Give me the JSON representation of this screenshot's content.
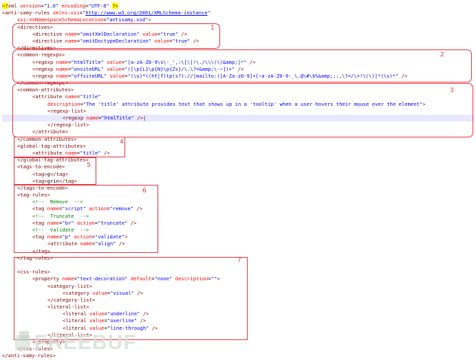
{
  "code": {
    "lines": [
      {
        "indent": 0,
        "parts": [
          {
            "c": "pi",
            "t": "<?"
          },
          {
            "c": "t",
            "t": "xml"
          },
          {
            "c": "a",
            "t": " version"
          },
          {
            "c": "x",
            "t": "="
          },
          {
            "c": "v",
            "t": "\"1.0\""
          },
          {
            "c": "a",
            "t": " encoding"
          },
          {
            "c": "x",
            "t": "="
          },
          {
            "c": "v",
            "t": "\"UTF-8\" "
          },
          {
            "c": "pi",
            "t": "?>"
          }
        ]
      },
      {
        "indent": 0,
        "parts": [
          {
            "c": "t",
            "t": "<anti-samy-rules"
          },
          {
            "c": "a",
            "t": " xmlns:xsi"
          },
          {
            "c": "x",
            "t": "="
          },
          {
            "c": "v",
            "t": "\""
          },
          {
            "c": "u",
            "t": "http://www.w3.org/2001/XMLSchema-instance"
          },
          {
            "c": "v",
            "t": "\""
          }
        ]
      },
      {
        "indent": 1,
        "parts": [
          {
            "c": "a",
            "t": "xsi:noNamespaceSchemaLocation"
          },
          {
            "c": "x",
            "t": "="
          },
          {
            "c": "v",
            "t": "\"antisamy.xsd\""
          },
          {
            "c": "t",
            "t": ">"
          }
        ]
      },
      {
        "indent": 1,
        "parts": [
          {
            "c": "t",
            "t": "<directives>"
          }
        ]
      },
      {
        "indent": 2,
        "parts": [
          {
            "c": "t",
            "t": "<directive"
          },
          {
            "c": "a",
            "t": " name"
          },
          {
            "c": "x",
            "t": "="
          },
          {
            "c": "v",
            "t": "\"omitXmlDeclaration\""
          },
          {
            "c": "a",
            "t": " value"
          },
          {
            "c": "x",
            "t": "="
          },
          {
            "c": "v",
            "t": "\"true\""
          },
          {
            "c": "t",
            "t": " />"
          }
        ]
      },
      {
        "indent": 2,
        "parts": [
          {
            "c": "t",
            "t": "<directive"
          },
          {
            "c": "a",
            "t": " name"
          },
          {
            "c": "x",
            "t": "="
          },
          {
            "c": "v",
            "t": "\"omitDoctypeDeclaration\""
          },
          {
            "c": "a",
            "t": " value"
          },
          {
            "c": "x",
            "t": "="
          },
          {
            "c": "v",
            "t": "\"true\""
          },
          {
            "c": "t",
            "t": " />"
          }
        ]
      },
      {
        "indent": 1,
        "parts": [
          {
            "c": "t",
            "t": "</directives>"
          }
        ]
      },
      {
        "indent": 1,
        "parts": [
          {
            "c": "t",
            "t": "<common-regexps>"
          }
        ]
      },
      {
        "indent": 2,
        "parts": [
          {
            "c": "t",
            "t": "<regexp"
          },
          {
            "c": "a",
            "t": " name"
          },
          {
            "c": "x",
            "t": "="
          },
          {
            "c": "v",
            "t": "\"htmlTitle\""
          },
          {
            "c": "a",
            "t": " value"
          },
          {
            "c": "x",
            "t": "="
          },
          {
            "c": "v",
            "t": "\"[a-zA-Z0-9\\s\\-_',:\\[\\]!\\./\\\\\\(\\)&amp;]*\""
          },
          {
            "c": "t",
            "t": " />"
          }
        ]
      },
      {
        "indent": 2,
        "parts": [
          {
            "c": "t",
            "t": "<regexp"
          },
          {
            "c": "a",
            "t": " name"
          },
          {
            "c": "x",
            "t": "="
          },
          {
            "c": "v",
            "t": "\"onsiteURL\""
          },
          {
            "c": "a",
            "t": " value"
          },
          {
            "c": "x",
            "t": "="
          },
          {
            "c": "v",
            "t": "\"([\\p{L}\\p{N}\\p{Zs}/\\.\\?=&amp;\\-~])+\""
          },
          {
            "c": "t",
            "t": " />"
          }
        ]
      },
      {
        "indent": 2,
        "parts": [
          {
            "c": "t",
            "t": "<regexp"
          },
          {
            "c": "a",
            "t": " name"
          },
          {
            "c": "x",
            "t": "="
          },
          {
            "c": "v",
            "t": "\"offsiteURL\""
          },
          {
            "c": "a",
            "t": " value"
          },
          {
            "c": "x",
            "t": "="
          },
          {
            "c": "v",
            "t": "\"(\\s)*((ht|f)tp(s?)://|mailto:)[A-Za-z0-9]+[~a-zA-Z0-9-_\\.@\\#\\$%&amp;;:,\\?=/\\+!\\(\\)]*(\\s)*\""
          },
          {
            "c": "t",
            "t": " />"
          }
        ]
      },
      {
        "indent": 1,
        "parts": [
          {
            "c": "t",
            "t": "</common-regexps>"
          }
        ]
      },
      {
        "indent": 1,
        "parts": [
          {
            "c": "t",
            "t": "<common-attributes>"
          }
        ]
      },
      {
        "indent": 2,
        "parts": [
          {
            "c": "t",
            "t": "<attribute"
          },
          {
            "c": "a",
            "t": " name"
          },
          {
            "c": "x",
            "t": "="
          },
          {
            "c": "v",
            "t": "\"title\""
          }
        ]
      },
      {
        "indent": 3,
        "parts": [
          {
            "c": "a",
            "t": "description"
          },
          {
            "c": "x",
            "t": "="
          },
          {
            "c": "v",
            "t": "\"The 'title' attribute provides text that shows up in a 'tooltip' when a user hovers their mouse over the element\""
          },
          {
            "c": "t",
            "t": ">"
          }
        ]
      },
      {
        "indent": 3,
        "parts": [
          {
            "c": "t",
            "t": "<regexp-list>"
          }
        ]
      },
      {
        "indent": 4,
        "hl": true,
        "parts": [
          {
            "c": "t",
            "t": "<regexp"
          },
          {
            "c": "a",
            "t": " name"
          },
          {
            "c": "x",
            "t": "="
          },
          {
            "c": "v",
            "t": "\"htmlTitle\""
          },
          {
            "c": "t",
            "t": " />"
          },
          {
            "c": "x",
            "t": "|"
          }
        ]
      },
      {
        "indent": 3,
        "parts": [
          {
            "c": "t",
            "t": "</regexp-list>"
          }
        ]
      },
      {
        "indent": 2,
        "parts": [
          {
            "c": "t",
            "t": "</attribute>"
          }
        ]
      },
      {
        "indent": 1,
        "parts": [
          {
            "c": "t",
            "t": "</common-attributes>"
          }
        ]
      },
      {
        "indent": 1,
        "parts": [
          {
            "c": "t",
            "t": "<global-tag-attributes>"
          }
        ]
      },
      {
        "indent": 2,
        "parts": [
          {
            "c": "t",
            "t": "<attribute"
          },
          {
            "c": "a",
            "t": " name"
          },
          {
            "c": "x",
            "t": "="
          },
          {
            "c": "v",
            "t": "\"title\""
          },
          {
            "c": "t",
            "t": " />"
          }
        ]
      },
      {
        "indent": 1,
        "parts": [
          {
            "c": "t",
            "t": "</global-tag-attributes>"
          }
        ]
      },
      {
        "indent": 1,
        "parts": [
          {
            "c": "t",
            "t": "<tags-to-encode>"
          }
        ]
      },
      {
        "indent": 2,
        "parts": [
          {
            "c": "t",
            "t": "<tag>"
          },
          {
            "c": "x",
            "t": "g"
          },
          {
            "c": "t",
            "t": "</tag>"
          }
        ]
      },
      {
        "indent": 2,
        "parts": [
          {
            "c": "t",
            "t": "<tag>"
          },
          {
            "c": "x",
            "t": "grin"
          },
          {
            "c": "t",
            "t": "</tag>"
          }
        ]
      },
      {
        "indent": 1,
        "parts": [
          {
            "c": "t",
            "t": "</tags-to-encode>"
          }
        ]
      },
      {
        "indent": 1,
        "parts": [
          {
            "c": "t",
            "t": "<tag-rules>"
          }
        ]
      },
      {
        "indent": 2,
        "parts": [
          {
            "c": "c",
            "t": "<!--  Remove  -->"
          }
        ]
      },
      {
        "indent": 2,
        "parts": [
          {
            "c": "t",
            "t": "<tag"
          },
          {
            "c": "a",
            "t": " name"
          },
          {
            "c": "x",
            "t": "="
          },
          {
            "c": "v",
            "t": "\"script\""
          },
          {
            "c": "a",
            "t": " action"
          },
          {
            "c": "x",
            "t": "="
          },
          {
            "c": "v",
            "t": "\"remove\""
          },
          {
            "c": "t",
            "t": " />"
          }
        ]
      },
      {
        "indent": 2,
        "parts": [
          {
            "c": "c",
            "t": "<!--  Truncate  -->"
          }
        ]
      },
      {
        "indent": 2,
        "parts": [
          {
            "c": "t",
            "t": "<tag"
          },
          {
            "c": "a",
            "t": " name"
          },
          {
            "c": "x",
            "t": "="
          },
          {
            "c": "v",
            "t": "\"br\""
          },
          {
            "c": "a",
            "t": " action"
          },
          {
            "c": "x",
            "t": "="
          },
          {
            "c": "v",
            "t": "\"truncate\""
          },
          {
            "c": "t",
            "t": " />"
          }
        ]
      },
      {
        "indent": 2,
        "parts": [
          {
            "c": "c",
            "t": "<!--  Validate  -->"
          }
        ]
      },
      {
        "indent": 2,
        "parts": [
          {
            "c": "t",
            "t": "<tag"
          },
          {
            "c": "a",
            "t": " name"
          },
          {
            "c": "x",
            "t": "="
          },
          {
            "c": "v",
            "t": "\"p\""
          },
          {
            "c": "a",
            "t": " action"
          },
          {
            "c": "x",
            "t": "="
          },
          {
            "c": "v",
            "t": "\"validate\""
          },
          {
            "c": "t",
            "t": ">"
          }
        ]
      },
      {
        "indent": 3,
        "parts": [
          {
            "c": "t",
            "t": "<attribute"
          },
          {
            "c": "a",
            "t": " name"
          },
          {
            "c": "x",
            "t": "="
          },
          {
            "c": "v",
            "t": "\"align\""
          },
          {
            "c": "t",
            "t": " />"
          }
        ]
      },
      {
        "indent": 2,
        "parts": [
          {
            "c": "t",
            "t": "</tag>"
          }
        ]
      },
      {
        "indent": 1,
        "parts": [
          {
            "c": "t",
            "t": "</tag-rules>"
          }
        ]
      },
      {
        "indent": 0,
        "parts": [
          {
            "c": "x",
            "t": ""
          }
        ]
      },
      {
        "indent": 1,
        "parts": [
          {
            "c": "t",
            "t": "<css-rules>"
          }
        ]
      },
      {
        "indent": 2,
        "parts": [
          {
            "c": "t",
            "t": "<property"
          },
          {
            "c": "a",
            "t": " name"
          },
          {
            "c": "x",
            "t": "="
          },
          {
            "c": "v",
            "t": "\"text-decoration\""
          },
          {
            "c": "a",
            "t": " default"
          },
          {
            "c": "x",
            "t": "="
          },
          {
            "c": "v",
            "t": "\"none\""
          },
          {
            "c": "a",
            "t": " description"
          },
          {
            "c": "x",
            "t": "="
          },
          {
            "c": "v",
            "t": "\"\""
          },
          {
            "c": "t",
            "t": ">"
          }
        ]
      },
      {
        "indent": 3,
        "parts": [
          {
            "c": "t",
            "t": "<category-list>"
          }
        ]
      },
      {
        "indent": 4,
        "parts": [
          {
            "c": "t",
            "t": "<category"
          },
          {
            "c": "a",
            "t": " value"
          },
          {
            "c": "x",
            "t": "="
          },
          {
            "c": "v",
            "t": "\"visual\""
          },
          {
            "c": "t",
            "t": " />"
          }
        ]
      },
      {
        "indent": 3,
        "parts": [
          {
            "c": "t",
            "t": "</category-list>"
          }
        ]
      },
      {
        "indent": 3,
        "parts": [
          {
            "c": "t",
            "t": "<literal-list>"
          }
        ]
      },
      {
        "indent": 4,
        "parts": [
          {
            "c": "t",
            "t": "<literal"
          },
          {
            "c": "a",
            "t": " value"
          },
          {
            "c": "x",
            "t": "="
          },
          {
            "c": "v",
            "t": "\"underline\""
          },
          {
            "c": "t",
            "t": " />"
          }
        ]
      },
      {
        "indent": 4,
        "parts": [
          {
            "c": "t",
            "t": "<literal"
          },
          {
            "c": "a",
            "t": " value"
          },
          {
            "c": "x",
            "t": "="
          },
          {
            "c": "v",
            "t": "\"overline\""
          },
          {
            "c": "t",
            "t": " />"
          }
        ]
      },
      {
        "indent": 4,
        "parts": [
          {
            "c": "t",
            "t": "<literal"
          },
          {
            "c": "a",
            "t": " value"
          },
          {
            "c": "x",
            "t": "="
          },
          {
            "c": "v",
            "t": "\"line-through\""
          },
          {
            "c": "t",
            "t": " />"
          }
        ]
      },
      {
        "indent": 3,
        "parts": [
          {
            "c": "t",
            "t": "</literal-list>"
          }
        ]
      },
      {
        "indent": 2,
        "parts": [
          {
            "c": "t",
            "t": "</property>"
          }
        ]
      },
      {
        "indent": 1,
        "parts": [
          {
            "c": "t",
            "t": "</css-rules>"
          }
        ]
      },
      {
        "indent": 0,
        "parts": [
          {
            "c": "t",
            "t": "</anti-samy-rules>"
          }
        ]
      }
    ]
  },
  "annotations": [
    "1",
    "2",
    "3",
    "4",
    "5",
    "6",
    "7"
  ],
  "watermark": "FREEBUF",
  "colors": {
    "annotation": "#e6323c",
    "tag": "#800000",
    "attribute": "#ff0000",
    "value": "#0000ff",
    "comment": "#008000"
  }
}
